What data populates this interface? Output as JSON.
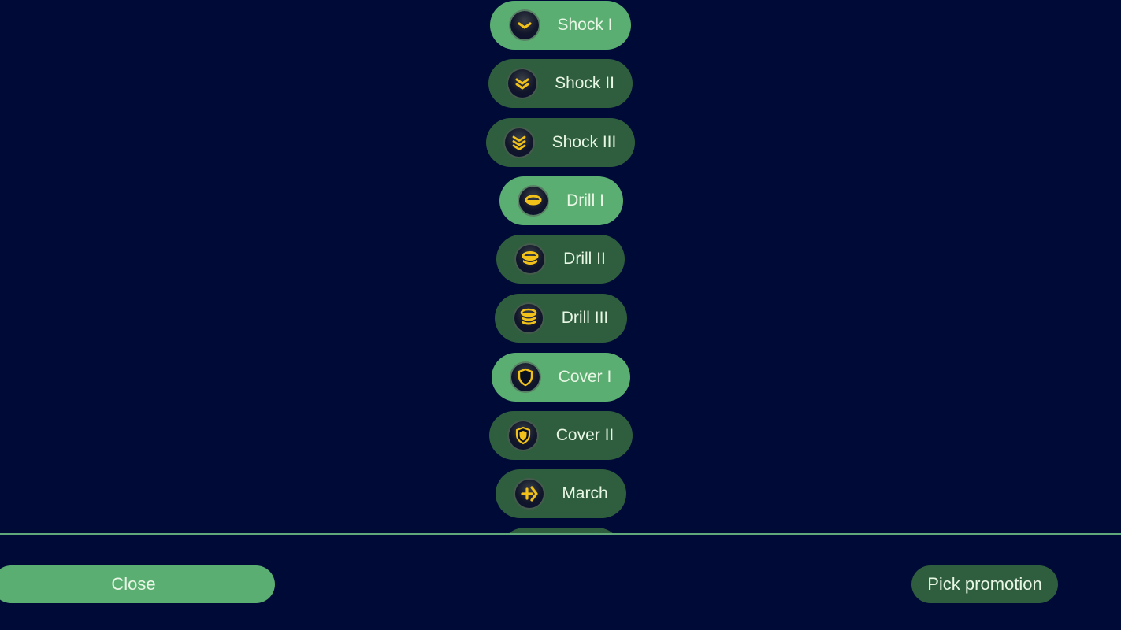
{
  "promotions": [
    {
      "label": "Shock I",
      "icon": "chevron-1-icon",
      "state": "available"
    },
    {
      "label": "Shock II",
      "icon": "chevron-2-icon",
      "state": "taken"
    },
    {
      "label": "Shock III",
      "icon": "chevron-3-icon",
      "state": "taken"
    },
    {
      "label": "Drill I",
      "icon": "drill-1-icon",
      "state": "available"
    },
    {
      "label": "Drill II",
      "icon": "drill-2-icon",
      "state": "taken"
    },
    {
      "label": "Drill III",
      "icon": "drill-3-icon",
      "state": "taken"
    },
    {
      "label": "Cover I",
      "icon": "shield-outline-icon",
      "state": "available"
    },
    {
      "label": "Cover II",
      "icon": "shield-filled-icon",
      "state": "taken"
    },
    {
      "label": "March",
      "icon": "march-plus-arrow-icon",
      "state": "taken"
    }
  ],
  "buttons": {
    "close": "Close",
    "pick_promotion": "Pick promotion"
  },
  "colors": {
    "background": "#000a36",
    "available": "#5aae72",
    "taken": "#2f5e3e",
    "icon_gold": "#f2c21a"
  }
}
